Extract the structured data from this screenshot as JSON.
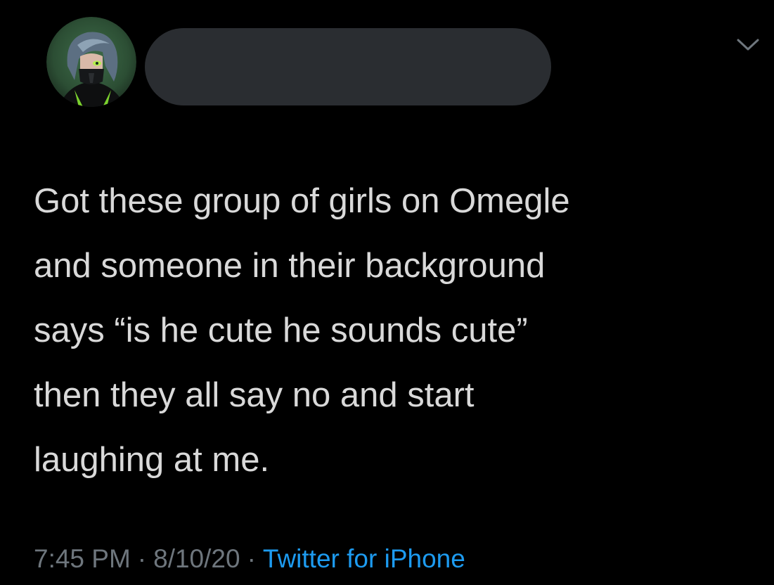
{
  "tweet": {
    "author": {
      "avatar_icon": "avatar-image",
      "name_redacted": true
    },
    "menu_icon": "chevron-down-icon",
    "text_lines": [
      "Got these group of girls on Omegle",
      "and someone in their background",
      "says “is he cute he sounds cute”",
      "then they all say no and start",
      "laughing at me."
    ],
    "meta": {
      "time": "7:45 PM",
      "separator": "·",
      "date": "8/10/20",
      "source": "Twitter for iPhone"
    }
  },
  "colors": {
    "background": "#000000",
    "text": "#d9d9d9",
    "muted": "#6e767d",
    "link": "#1d9bf0",
    "redaction": "#2a2d31"
  }
}
